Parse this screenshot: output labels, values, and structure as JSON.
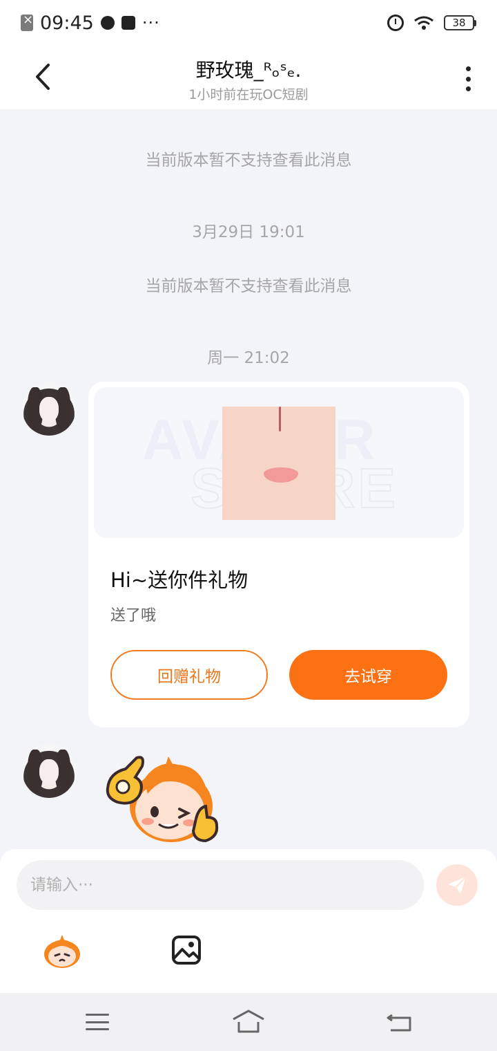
{
  "status_bar": {
    "time": "09:45",
    "more": "···",
    "battery": "38"
  },
  "header": {
    "title": "野玫瑰_ᴿₒˢₑ.",
    "subtitle": "1小时前在玩OC短剧"
  },
  "messages": {
    "system_1": "当前版本暂不支持查看此消息",
    "time_1": "3月29日 19:01",
    "system_2": "当前版本暂不支持查看此消息",
    "time_2": "周一 21:02"
  },
  "gift_card": {
    "title": "Hi~送你件礼物",
    "desc": "送了哦",
    "return_label": "回赠礼物",
    "try_label": "去试穿"
  },
  "input": {
    "placeholder": "请输入···"
  },
  "icons": {
    "back": "chevron-left-icon",
    "more": "more-vertical-icon",
    "send": "send-icon",
    "emoji": "sticker-mascot-icon",
    "image": "image-icon"
  },
  "colors": {
    "accent": "#fb7113",
    "background": "#f3f4f8"
  }
}
